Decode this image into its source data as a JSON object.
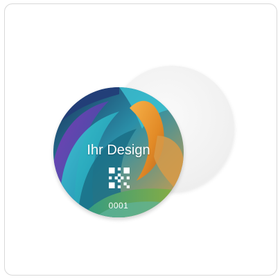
{
  "preview": {
    "design_text": "Ihr Design",
    "serial_number": "0001",
    "qr_icon": "qr-code-icon"
  },
  "colors": {
    "border": "#d9d9d9",
    "back_disc": "#f1f1f1",
    "label_text": "#ffffff"
  }
}
